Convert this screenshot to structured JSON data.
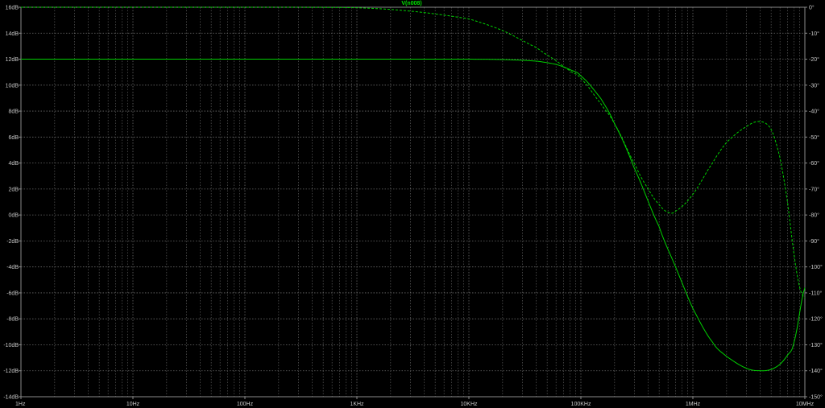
{
  "chart_data": {
    "type": "line",
    "title": "V(n008)",
    "xscale": "log",
    "xlim_hz": [
      1,
      10000000
    ],
    "x_tick_labels": [
      "1Hz",
      "10Hz",
      "100Hz",
      "1KHz",
      "10KHz",
      "100KHz",
      "1MHz",
      "10MHz"
    ],
    "y_left_ticks": [
      "16dB",
      "14dB",
      "12dB",
      "10dB",
      "8dB",
      "6dB",
      "4dB",
      "2dB",
      "0dB",
      "-2dB",
      "-4dB",
      "-6dB",
      "-8dB",
      "-10dB",
      "-12dB",
      "-14dB"
    ],
    "ylim_left_db": [
      -14,
      16
    ],
    "y_right_ticks": [
      "0°",
      "-10°",
      "-20°",
      "-30°",
      "-40°",
      "-50°",
      "-60°",
      "-70°",
      "-80°",
      "-90°",
      "-100°",
      "-110°",
      "-120°",
      "-130°",
      "-140°",
      "-150°"
    ],
    "ylim_right_deg": [
      -150,
      0
    ],
    "grid": true,
    "colors": {
      "background": "#000000",
      "grid": "#6a6a6a",
      "trace": "#00d000",
      "text": "#c8c8c8"
    },
    "series": [
      {
        "axis": "left",
        "style": "solid",
        "x": [
          1,
          10,
          100,
          1000,
          10000,
          20000,
          40000,
          60000,
          80000,
          100000,
          150000,
          200000,
          300000,
          500000,
          700000,
          1000000,
          1500000,
          2000000,
          3000000,
          4000000,
          5000000,
          6000000,
          7000000,
          8000000,
          10000000
        ],
        "y": [
          12.0,
          12.0,
          12.0,
          12.0,
          12.0,
          11.97,
          11.85,
          11.6,
          11.2,
          10.7,
          9.0,
          7.0,
          3.6,
          -0.9,
          -4.0,
          -7.2,
          -9.8,
          -10.9,
          -11.8,
          -12.0,
          -11.9,
          -11.5,
          -10.8,
          -9.8,
          -5.6
        ]
      },
      {
        "axis": "right",
        "style": "dashed",
        "x": [
          1,
          10,
          100,
          1000,
          3000,
          10000,
          20000,
          40000,
          60000,
          80000,
          100000,
          150000,
          200000,
          300000,
          400000,
          500000,
          600000,
          700000,
          1000000,
          1500000,
          2000000,
          3000000,
          4000000,
          5000000,
          6000000,
          7000000,
          8000000,
          9000000,
          10000000
        ],
        "y": [
          0,
          0,
          0,
          -0.2,
          -1.5,
          -4.5,
          -9,
          -15.5,
          -20.5,
          -24.5,
          -27.5,
          -37,
          -45,
          -60,
          -70,
          -76,
          -79,
          -78.5,
          -72,
          -60,
          -52,
          -46,
          -44,
          -47,
          -58,
          -75,
          -95,
          -108,
          -112
        ]
      }
    ]
  }
}
